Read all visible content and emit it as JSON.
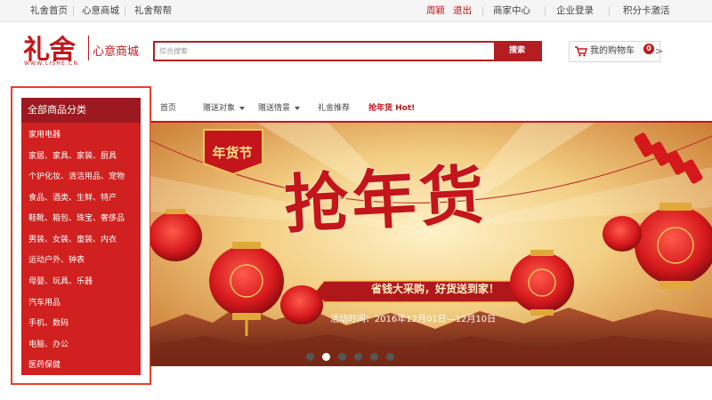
{
  "topbar": {
    "left_links": [
      "礼舍首页",
      "心意商城",
      "礼舍帮帮"
    ],
    "user_name": "周颖",
    "logout": "退出",
    "right_links": [
      "商家中心",
      "企业登录",
      "积分卡激活"
    ]
  },
  "header": {
    "logo_text": "礼舍",
    "logo_sub": "WWW.LISHE.CN",
    "mall_name": "心意商城"
  },
  "search": {
    "placeholder": "综合搜索",
    "button_label": "搜索"
  },
  "cart": {
    "label": "我的购物车",
    "count": "0",
    "chevron": ">"
  },
  "nav": {
    "home": "首页",
    "items_with_caret": [
      "赠送对象",
      "赠送情景"
    ],
    "recommend": "礼舍推荐",
    "hot": "抢年货 Hot!"
  },
  "categories": {
    "heading": "全部商品分类",
    "items": [
      "家用电器",
      "家居、家具、家装、厨具",
      "个护化妆、清洁用品、宠物",
      "食品、酒类、生鲜、特产",
      "鞋靴、箱包、珠宝、奢侈品",
      "男装、女装、童装、内衣",
      "运动户外、钟表",
      "母婴、玩具、乐器",
      "汽车用品",
      "手机、数码",
      "电脑、办公",
      "医药保健"
    ]
  },
  "banner": {
    "badge": "年货节",
    "headline": "抢年货",
    "ribbon": "省钱大采购，好货送到家！",
    "date": "活动时间：2016年12月01日—12月10日",
    "carousel_count": 6,
    "active_index": 1
  },
  "colors": {
    "brand_red": "#c4161c",
    "sidebar_red": "#d0201f",
    "sidebar_head": "#9c1a1f",
    "highlight_outline": "#e8402a"
  }
}
